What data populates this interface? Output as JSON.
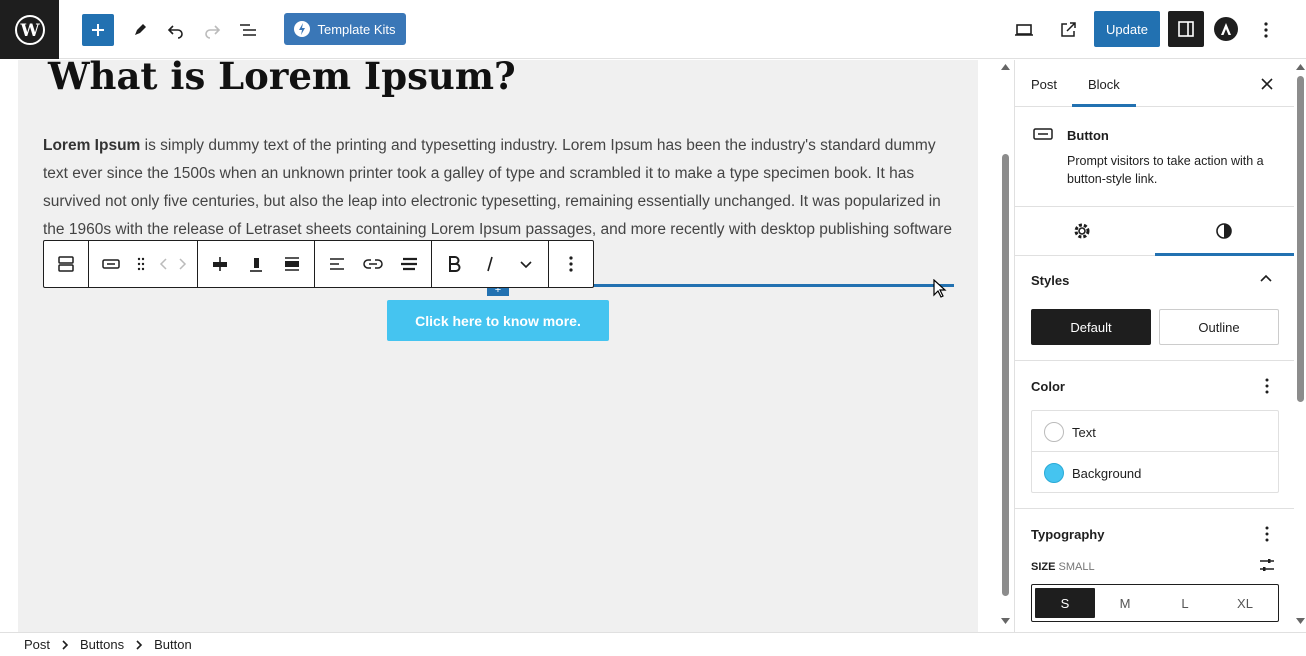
{
  "topbar": {
    "template_kits_label": "Template Kits",
    "update_label": "Update"
  },
  "canvas": {
    "heading": "What is Lorem Ipsum?",
    "paragraph_bold": "Lorem Ipsum",
    "paragraph_rest": " is simply dummy text of the printing and typesetting industry. Lorem Ipsum has been the industry's standard dummy text ever since the 1500s when an unknown printer took a galley of type and scrambled it to make a type specimen book. It has survived not only five centuries, but also the leap into electronic typesetting, remaining essentially unchanged. It was popularized in the 1960s with the release of Letraset sheets containing Lorem Ipsum passages, and more recently with desktop publishing software like Aldus PageMaker including versions of Lorem Ipsum.",
    "button_text": "Click here to know more."
  },
  "sidebar": {
    "tabs": [
      "Post",
      "Block"
    ],
    "active_tab": "Block",
    "block_title": "Button",
    "block_desc": "Prompt visitors to take action with a button-style link.",
    "styles_title": "Styles",
    "style_default": "Default",
    "style_outline": "Outline",
    "color_title": "Color",
    "color_text_label": "Text",
    "color_bg_label": "Background",
    "bg_color": "#45c4f0",
    "typography_title": "Typography",
    "size_label": "SIZE",
    "size_value": "SMALL",
    "sizes": [
      "S",
      "M",
      "L",
      "XL"
    ]
  },
  "breadcrumb": [
    "Post",
    "Buttons",
    "Button"
  ],
  "colors": {
    "accent": "#2271b1",
    "dark": "#1e1e1e",
    "button_bg": "#45c4f0"
  }
}
